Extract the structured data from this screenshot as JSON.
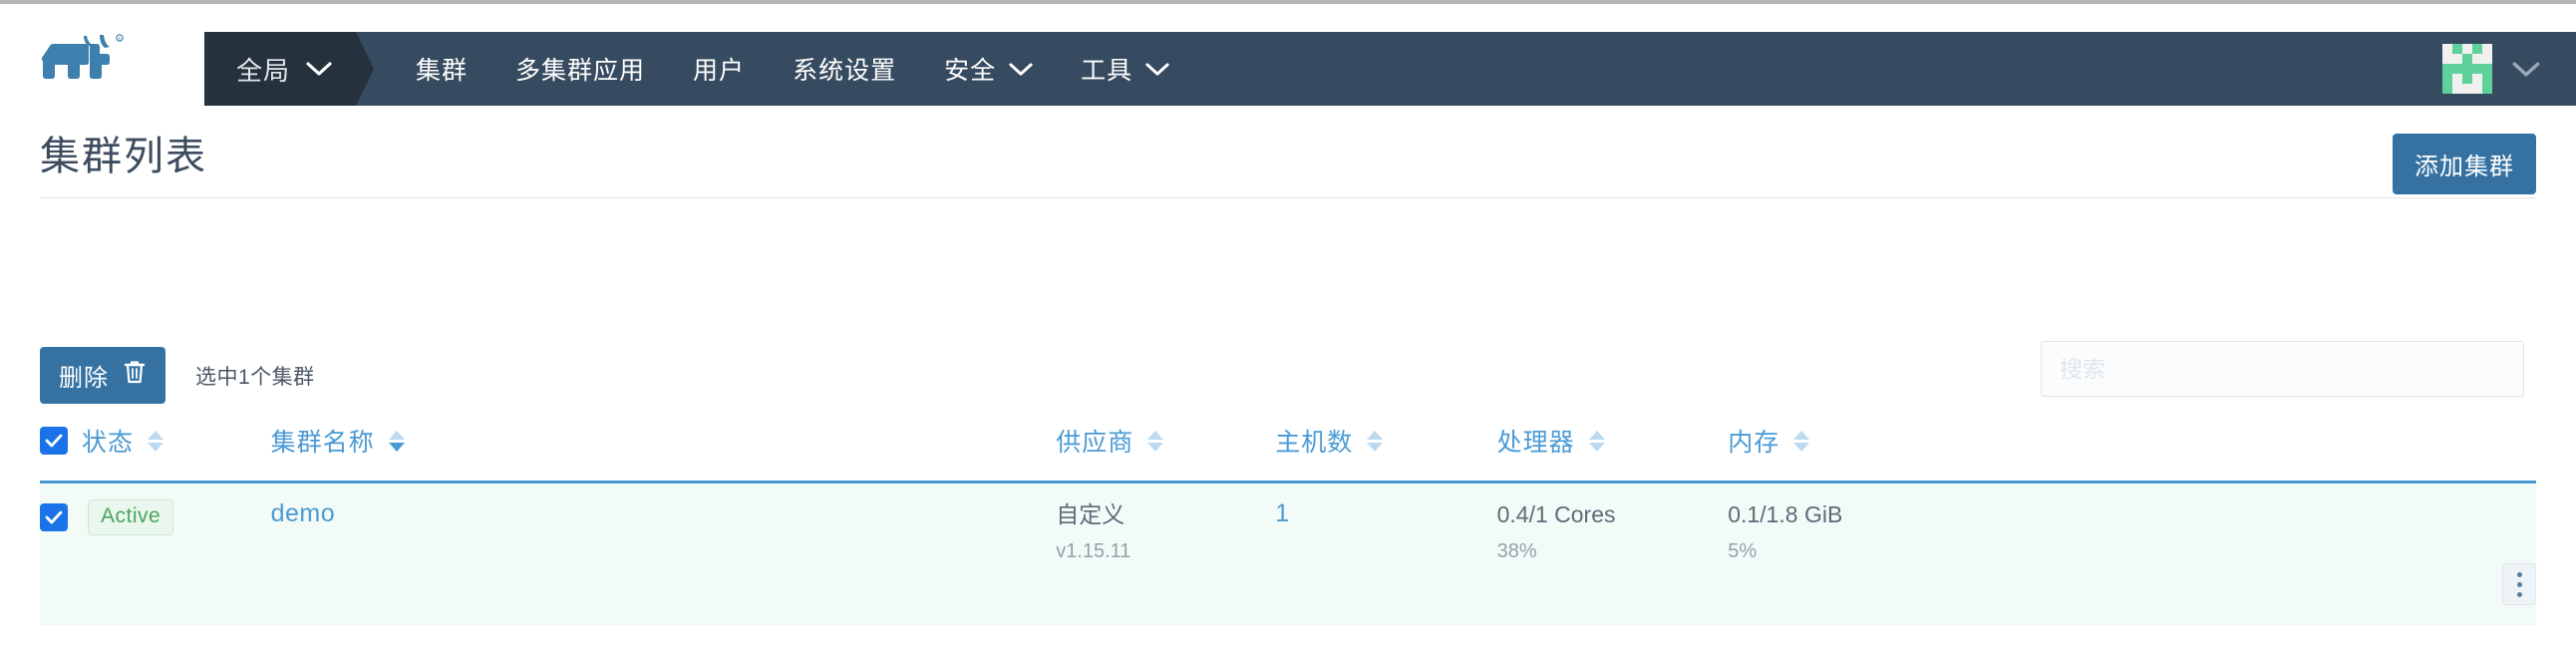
{
  "header": {
    "logo_alt": "rancher-logo",
    "scope": {
      "label": "全局",
      "icon": "chevron-down-icon"
    },
    "nav_items": [
      {
        "label": "集群",
        "has_caret": false
      },
      {
        "label": "多集群应用",
        "has_caret": false
      },
      {
        "label": "用户",
        "has_caret": false
      },
      {
        "label": "系统设置",
        "has_caret": false
      },
      {
        "label": "安全",
        "has_caret": true
      },
      {
        "label": "工具",
        "has_caret": true
      }
    ],
    "avatar": {
      "name": "user-avatar-identicon",
      "accent": "#5ed19b"
    },
    "avatar_caret": "chevron-down-icon"
  },
  "page": {
    "title": "集群列表",
    "add_button": "添加集群"
  },
  "toolbar": {
    "delete_label": "删除",
    "delete_icon": "trash-icon",
    "selection_text": "选中1个集群",
    "search_placeholder": "搜索",
    "search_value": ""
  },
  "table": {
    "columns": [
      {
        "label": "状态",
        "sort": "none"
      },
      {
        "label": "集群名称",
        "sort": "desc"
      },
      {
        "label": "供应商",
        "sort": "none"
      },
      {
        "label": "主机数",
        "sort": "none"
      },
      {
        "label": "处理器",
        "sort": "none"
      },
      {
        "label": "内存",
        "sort": "none"
      }
    ],
    "rows": [
      {
        "selected": true,
        "status": "Active",
        "name": "demo",
        "provider": "自定义",
        "provider_version": "v1.15.11",
        "nodes": "1",
        "cpu": "0.4/1 Cores",
        "cpu_pct": "38%",
        "memory": "0.1/1.8 GiB",
        "memory_pct": "5%",
        "menu_icon": "kebab-menu-icon"
      }
    ]
  },
  "colors": {
    "navbar": "#374b60",
    "navbar_scope": "#25313d",
    "primary": "#3672a1",
    "link": "#4a9ad4",
    "status_green": "#4aa45e",
    "row_bg": "#f2fbf7"
  }
}
